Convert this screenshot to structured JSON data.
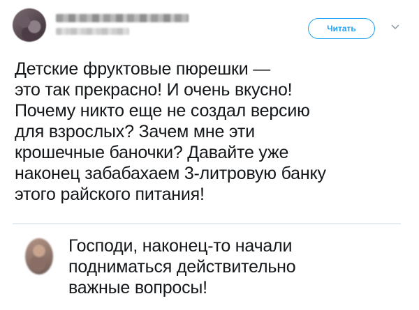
{
  "tweet": {
    "follow_label": "Читать",
    "text": "Детские фруктовые пюрешки —\nэто так прекрасно! И очень вкусно!\nПочему никто еще не создал версию\nдля взрослых? Зачем мне эти\nкрошечные баночки? Давайте уже\nнаконец забабахаем 3-литровую банку\nэтого райского питания!",
    "caret_icon": "chevron-down-icon"
  },
  "reply": {
    "text": "Господи, наконец-то начали\nподниматься действительно\nважные вопросы!"
  },
  "colors": {
    "accent": "#1da1f2",
    "text": "#14171a",
    "divider": "#e6ecf0"
  }
}
